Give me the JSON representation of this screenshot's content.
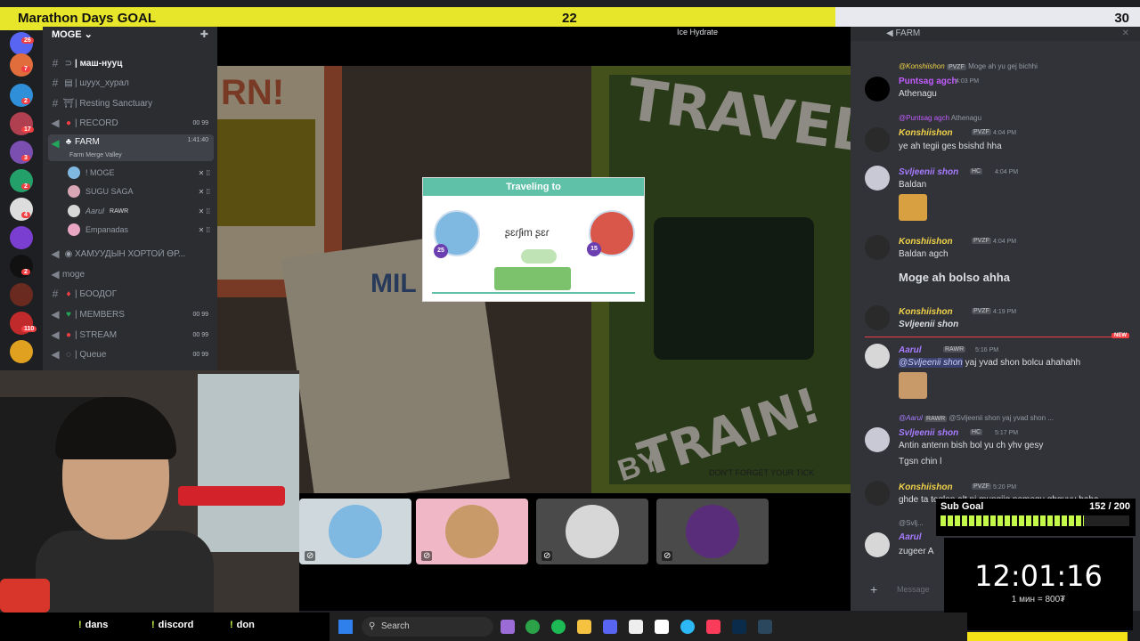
{
  "marathon": {
    "title": "Marathon Days GOAL",
    "current": "22",
    "target": "30",
    "progress": 0.733
  },
  "server": {
    "name": "MOGE ⌄"
  },
  "channels": [
    {
      "glyph": "#",
      "emoji": "⊃",
      "name": "| маш-нууц"
    },
    {
      "glyph": "#",
      "emoji": "▤",
      "name": "| шуух_хурал"
    },
    {
      "glyph": "#",
      "emoji": "⛩",
      "name": "| Resting Sanctuary"
    },
    {
      "glyph": "◀",
      "emoji": "●",
      "name": "| RECORD",
      "meta": "00 99"
    },
    {
      "glyph": "◀",
      "emoji": "♣",
      "name": "FARM",
      "meta": "1:41:40",
      "sub": "Farm Merge Valley"
    }
  ],
  "voice_users": [
    {
      "name": "! MOGE"
    },
    {
      "name": "SUGU SAGA"
    },
    {
      "name": "Aarul",
      "tag": "RAWR"
    },
    {
      "name": "Empanadas"
    }
  ],
  "channels_after": [
    {
      "glyph": "◀",
      "emoji": "◉",
      "name": "ХАМУУДЫН ХОРТОЙ ӨР..."
    },
    {
      "glyph": "◀",
      "emoji": "",
      "name": "moge"
    },
    {
      "glyph": "#",
      "emoji": "♦",
      "name": "| БООДОГ"
    },
    {
      "glyph": "◀",
      "emoji": "♥",
      "name": "| MEMBERS",
      "meta": "00 99"
    },
    {
      "glyph": "◀",
      "emoji": "●",
      "name": "| STREAM",
      "meta": "00 99"
    },
    {
      "glyph": "◀",
      "emoji": "◌",
      "name": "| Queue",
      "meta": "00 99"
    }
  ],
  "rail_badges": [
    "26",
    "7",
    "2",
    "17",
    "3",
    "2",
    "4",
    "2",
    "110",
    "3"
  ],
  "activity": {
    "hydrate": "Ice Hydrate",
    "popup_title": "Traveling to",
    "popup_script": "ʂɛɾʃɨm ʂɛɾ",
    "level_left": "25",
    "level_right": "15",
    "travel_word": "TRAVEL",
    "by_word": "BY",
    "train_word": "TRAIN!",
    "forget": "DON'T FORGET YOUR TICK",
    "left_card_word": "RN!",
    "milk_word": "MIL"
  },
  "chat": {
    "header": "FARM",
    "messages": [
      {
        "reply_name": "@Konshiishon",
        "reply_tag": "PVZF",
        "reply_text": "Moge ah yu gej bichhi",
        "user": "Puntsag agch",
        "time": "4:03 PM",
        "text": "Athenagu",
        "color": "#c35cff",
        "avatar": "#000000"
      },
      {
        "reply_name": "@Puntsag agch",
        "reply_text": "Athenagu",
        "user": "Konshiishon",
        "tag": "PVZF",
        "time": "4:04 PM",
        "text": "ye ah tegii ges bsishd hha",
        "color": "#f0d24a",
        "avatar": "#2a2a2a"
      },
      {
        "user": "Svljeenii shon",
        "tag": "HC",
        "time": "4:04 PM",
        "text": "Baldan",
        "color": "#a77bff",
        "avatar": "#c9c9d6"
      },
      {
        "user": "Konshiishon",
        "tag": "PVZF",
        "time": "4:04 PM",
        "text": "Baldan agch",
        "big": "Moge ah bolso ahha",
        "color": "#f0d24a",
        "avatar": "#2a2a2a"
      },
      {
        "user": "Konshiishon",
        "tag": "PVZF",
        "time": "4:19 PM",
        "text": "Svljeenii shon",
        "color": "#f0d24a",
        "avatar": "#2a2a2a"
      },
      {
        "user": "Aarul",
        "tag": "RAWR",
        "time": "5:16 PM",
        "mention": "@Svljeenii shon",
        "text": "yaj yvad shon bolcu ahahahh",
        "color": "#a77bff",
        "avatar": "#d7d7d7"
      },
      {
        "reply_name": "@Aarul",
        "reply_tag": "RAWR",
        "reply_text": "@Svljeenii shon yaj yvad shon ...",
        "user": "Svljeenii shon",
        "tag": "HC",
        "time": "5:17 PM",
        "text": "Antin antenn bish bol yu ch yhv gesy",
        "text2": "Tgsn chin l",
        "color": "#a77bff",
        "avatar": "#c9c9d6"
      },
      {
        "user": "Konshiishon",
        "tag": "PVZF",
        "time": "5:20 PM",
        "text": "ghde ta toglon alt nj mungiig nemegu ghguyu haha",
        "color": "#f0d24a",
        "avatar": "#2a2a2a"
      },
      {
        "reply_text": "@Svlj...",
        "user": "Aarul",
        "text": "zugeer A",
        "color": "#a77bff",
        "avatar": "#d7d7d7"
      }
    ],
    "new_label": "NEW",
    "input_placeholder": "Message"
  },
  "subgoal": {
    "label": "Sub Goal",
    "count": "152 / 200",
    "progress": 0.76
  },
  "timer": {
    "clock": "12:01:16",
    "rate": "1 мин = 800₮"
  },
  "commands": [
    {
      "bang": "!",
      "text": "dans"
    },
    {
      "bang": "!",
      "text": "discord"
    },
    {
      "bang": "!",
      "text": "don"
    }
  ],
  "taskbar": {
    "search": "Search"
  },
  "colors": {
    "marathon_fill": "#e8e62a",
    "subgoal_fill": "#c4f84a",
    "chat_bg": "#313338",
    "new_red": "#f23f43"
  }
}
